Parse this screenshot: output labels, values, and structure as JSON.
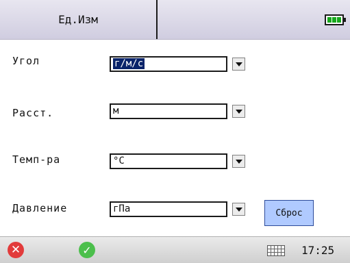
{
  "header": {
    "title": "Ед.Изм",
    "battery_icon": "battery-full-icon"
  },
  "rows": [
    {
      "label": "Угол",
      "value": "г/м/с",
      "selected": true
    },
    {
      "label": "Расст.",
      "value": "м",
      "selected": false
    },
    {
      "label": "Темп-ра",
      "value": "°С",
      "selected": false
    },
    {
      "label": "Давление",
      "value": "гПа",
      "selected": false
    }
  ],
  "reset_label": "Сброс",
  "taskbar": {
    "cancel_icon": "cancel-icon",
    "ok_icon": "ok-icon",
    "keyboard_icon": "keyboard-icon",
    "time": "17:25"
  }
}
